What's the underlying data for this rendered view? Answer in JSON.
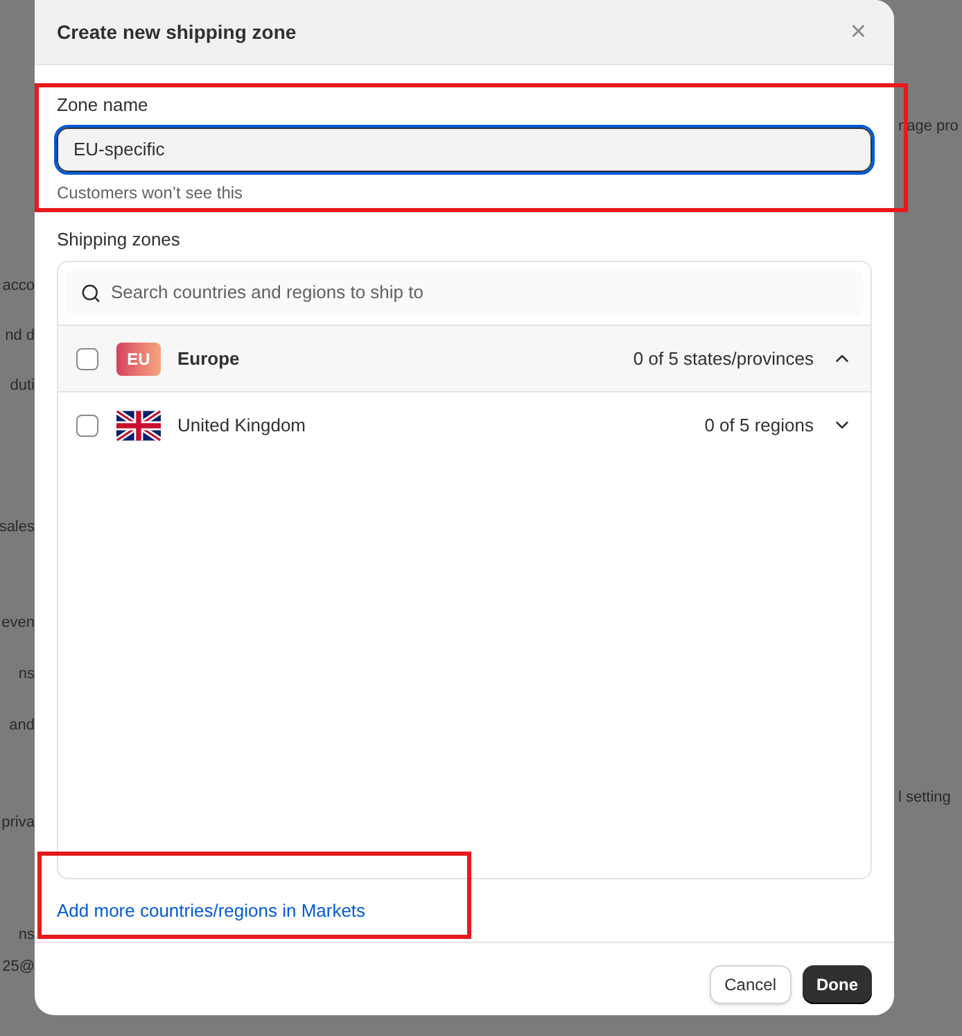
{
  "background": {
    "left_fragments": [
      "acco",
      "nd d",
      "duti",
      "sales",
      "even",
      "ns",
      "and",
      "priva",
      "ns",
      "25@"
    ],
    "right_fragments": [
      "nage pro",
      "l setting"
    ]
  },
  "dialog": {
    "title": "Create new shipping zone",
    "close": "×",
    "zone_name": {
      "label": "Zone name",
      "value": "EU-specific",
      "help": "Customers won’t see this"
    },
    "shipping_zones": {
      "label": "Shipping zones",
      "search": {
        "placeholder": "Search countries and regions to ship to"
      },
      "rows": [
        {
          "kind": "region",
          "badge": "EU",
          "name": "Europe",
          "count": "0 of 5 states/provinces",
          "checked": false,
          "expanded": true
        },
        {
          "kind": "country",
          "name": "United Kingdom",
          "count": "0 of 5 regions",
          "checked": false,
          "expanded": false
        }
      ]
    },
    "link": "Add more countries/regions in Markets",
    "buttons": [
      {
        "kind": "secondary",
        "label": "Cancel"
      },
      {
        "kind": "primary",
        "label": "Done"
      }
    ]
  }
}
